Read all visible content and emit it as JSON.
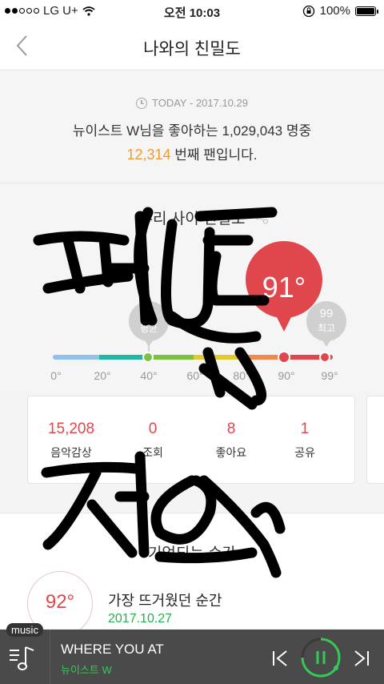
{
  "status_bar": {
    "carrier": "LG U+",
    "time": "오전 10:03",
    "battery": "100%"
  },
  "nav": {
    "title": "나와의 친밀도"
  },
  "today": {
    "label": "TODAY - 2017.10.29"
  },
  "fan": {
    "line1": "뉴이스트 W님을 좋아하는 1,029,043 명중",
    "rank": "12,314",
    "line2_suffix": " 번째 팬입니다."
  },
  "intimacy": {
    "title": "우리 사이 친밀도",
    "my_value": "91°",
    "avg_value": "42",
    "avg_label": "평균",
    "max_value": "99",
    "max_label": "최고",
    "my_level": 91,
    "avg_level": 42,
    "max_level": 99,
    "colors": {
      "accent": "#e0474c",
      "bubble_gray": "#d0d0d0"
    },
    "scale_labels": [
      "0°",
      "20°",
      "40°",
      "60°",
      "80°",
      "90°",
      "99°"
    ]
  },
  "stats": [
    {
      "value": "15,208",
      "label": "음악감상"
    },
    {
      "value": "0",
      "label": "조회"
    },
    {
      "value": "8",
      "label": "좋아요"
    },
    {
      "value": "1",
      "label": "공유"
    }
  ],
  "memory": {
    "title": "기억되는 순간",
    "temperature": "92°",
    "text": "가장 뜨거웠던 순간",
    "date": "2017.10.27"
  },
  "player": {
    "tag": "music",
    "song": "WHERE YOU AT",
    "artist": "뉴이스트 W"
  }
}
